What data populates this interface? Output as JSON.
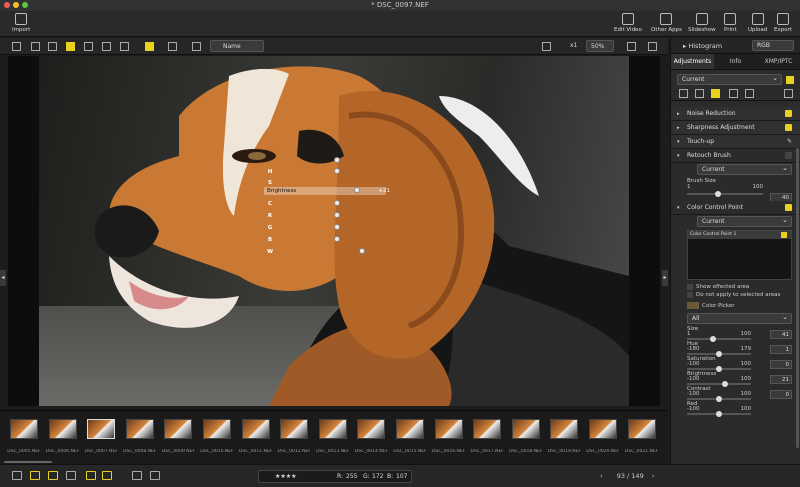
{
  "window": {
    "title": "* DSC_0097.NEF"
  },
  "toolbar": {
    "import": "Import",
    "edit_video": "Edit Video",
    "other_apps": "Other Apps",
    "slideshow": "Slideshow",
    "print": "Print",
    "upload": "Upload",
    "export": "Export"
  },
  "subtool": {
    "sort": "Name",
    "zoom": "50%",
    "x1": "x1"
  },
  "control_point": {
    "letters": [
      "H",
      "S",
      "B",
      "C",
      "R",
      "G",
      "B",
      "W"
    ],
    "slider_label": "Brightness",
    "slider_value": "+21"
  },
  "filmstrip": [
    "DSC_0005.NEF",
    "DSC_0006.NEF",
    "DSC_0007.NEF",
    "DSC_0008.NEF",
    "DSC_0009.NEF",
    "DSC_0010.NEF",
    "DSC_0011.NEF",
    "DSC_0012.NEF",
    "DSC_0013.NEF",
    "DSC_0014.NEF",
    "DSC_0015.NEF",
    "DSC_0016.NEF",
    "DSC_0017.NEF",
    "DSC_0018.NEF",
    "DSC_0019.NEF",
    "DSC_0020.NEF",
    "DSC_0021.NEF"
  ],
  "status": {
    "stars": "★★★★",
    "r": "255",
    "g": "172",
    "b": "107",
    "page": "93",
    "total": "149"
  },
  "panel": {
    "histogram": "Histogram",
    "hist_mode": "RGB",
    "tabs": [
      "Adjustments",
      "Info",
      "XMP/IPTC"
    ],
    "current": "Current",
    "noise": "Noise Reduction",
    "sharpness": "Sharpness Adjustment",
    "touchup": "Touch-up",
    "retouch": "Retouch Brush",
    "retouch_current": "Current",
    "brush_size": "Brush Size",
    "brush_min": "1",
    "brush_max": "100",
    "brush_val": "40",
    "ccp": "Color Control Point",
    "ccp_current": "Current",
    "ccp_item": "Color Control Point 1",
    "show_affected": "Show effected area",
    "not_apply": "Do not apply to selected areas",
    "color_picker": "Color Picker",
    "all": "All",
    "size": "Size",
    "size_min": "1",
    "size_max": "100",
    "size_val": "41",
    "hue": "Hue",
    "hue_min": "-180",
    "hue_max": "179",
    "hue_val": "1",
    "sat": "Saturation",
    "sat_min": "-100",
    "sat_max": "100",
    "sat_val": "0",
    "bri": "Brightness",
    "bri_min": "-100",
    "bri_max": "100",
    "bri_val": "21",
    "con": "Contrast",
    "con_min": "-100",
    "con_max": "100",
    "con_val": "0",
    "red": "Red",
    "red_min": "-100",
    "red_max": "100"
  }
}
